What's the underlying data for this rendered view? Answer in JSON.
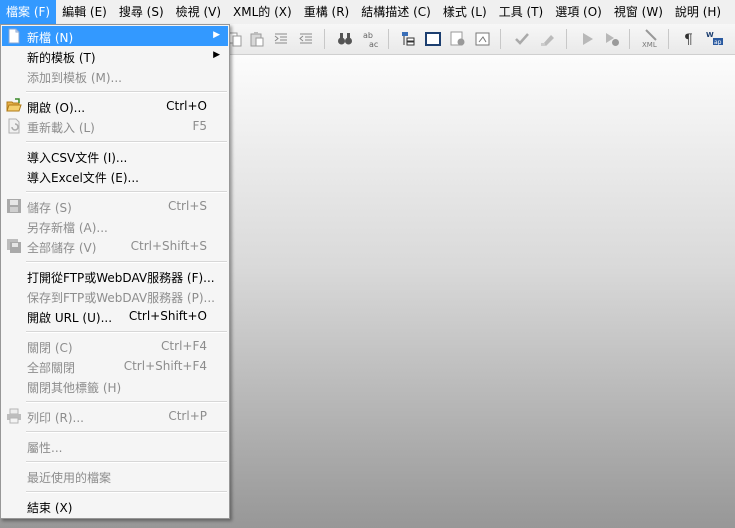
{
  "menubar": {
    "items": [
      {
        "label": "檔案 (F)",
        "active": true
      },
      {
        "label": "編輯 (E)"
      },
      {
        "label": "搜尋 (S)"
      },
      {
        "label": "檢視 (V)"
      },
      {
        "label": "XML的 (X)"
      },
      {
        "label": "重構 (R)"
      },
      {
        "label": "結構描述 (C)"
      },
      {
        "label": "樣式 (L)"
      },
      {
        "label": "工具 (T)"
      },
      {
        "label": "選項 (O)"
      },
      {
        "label": "視窗 (W)"
      },
      {
        "label": "說明 (H)"
      }
    ]
  },
  "toolbar": {
    "icons": [
      "copy-icon",
      "paste-icon",
      "indent-icon",
      "outdent-icon",
      "find-icon",
      "replace-icon",
      "tree-view-icon",
      "window-icon",
      "db-query-icon",
      "form-icon",
      "check-icon",
      "validate-icon",
      "run-icon",
      "run-config-icon",
      "xml-icon",
      "pilcrow-icon",
      "word-wrap-icon"
    ]
  },
  "file_menu": {
    "items": {
      "new": {
        "label": "新檔 (N)"
      },
      "new_template": {
        "label": "新的模板 (T)"
      },
      "add_template": {
        "label": "添加到模板 (M)..."
      },
      "open": {
        "label": "開啟 (O)...",
        "shortcut": "Ctrl+O"
      },
      "reload": {
        "label": "重新載入 (L)",
        "shortcut": "F5"
      },
      "import_csv": {
        "label": "導入CSV文件 (I)..."
      },
      "import_excel": {
        "label": "導入Excel文件 (E)..."
      },
      "save": {
        "label": "儲存 (S)",
        "shortcut": "Ctrl+S"
      },
      "save_as": {
        "label": "另存新檔 (A)..."
      },
      "save_all": {
        "label": "全部儲存 (V)",
        "shortcut": "Ctrl+Shift+S"
      },
      "open_ftp": {
        "label": "打開從FTP或WebDAV服務器 (F)..."
      },
      "save_ftp": {
        "label": "保存到FTP或WebDAV服務器 (P)..."
      },
      "open_url": {
        "label": "開啟 URL (U)...",
        "shortcut": "Ctrl+Shift+O"
      },
      "close": {
        "label": "關閉 (C)",
        "shortcut": "Ctrl+F4"
      },
      "close_all": {
        "label": "全部關閉",
        "shortcut": "Ctrl+Shift+F4"
      },
      "close_others": {
        "label": "關閉其他標籤 (H)"
      },
      "print": {
        "label": "列印 (R)...",
        "shortcut": "Ctrl+P"
      },
      "properties": {
        "label": "屬性..."
      },
      "recent": {
        "label": "最近使用的檔案"
      },
      "exit": {
        "label": "結束 (X)"
      }
    }
  },
  "colors": {
    "highlight": "#3399ff",
    "disabled_text": "#8d8d8d"
  }
}
